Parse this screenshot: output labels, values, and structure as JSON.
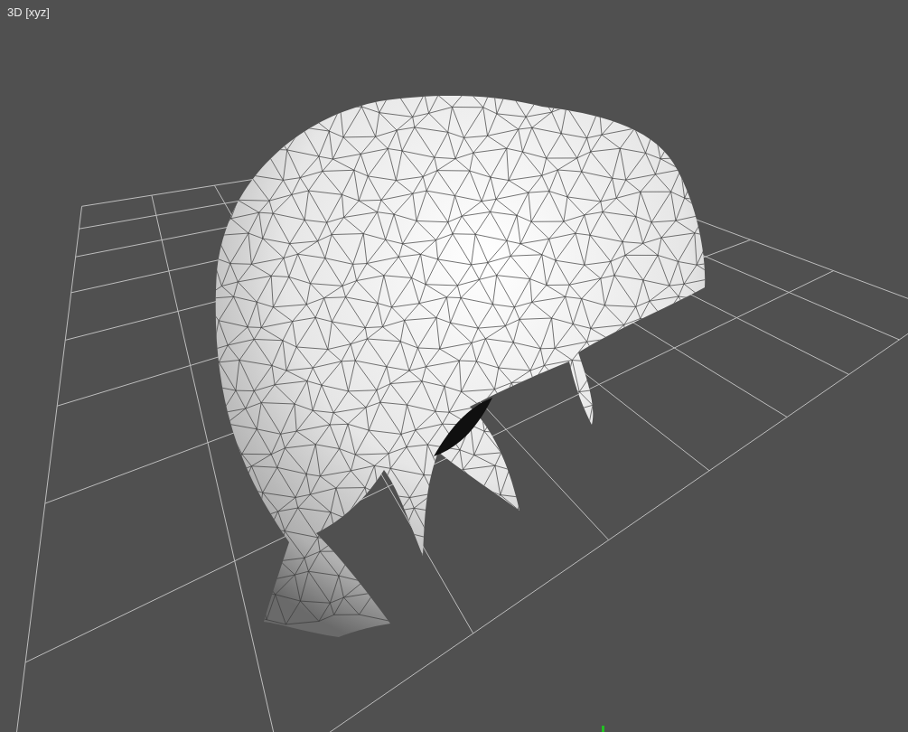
{
  "viewport": {
    "label": "3D [xyz]"
  }
}
